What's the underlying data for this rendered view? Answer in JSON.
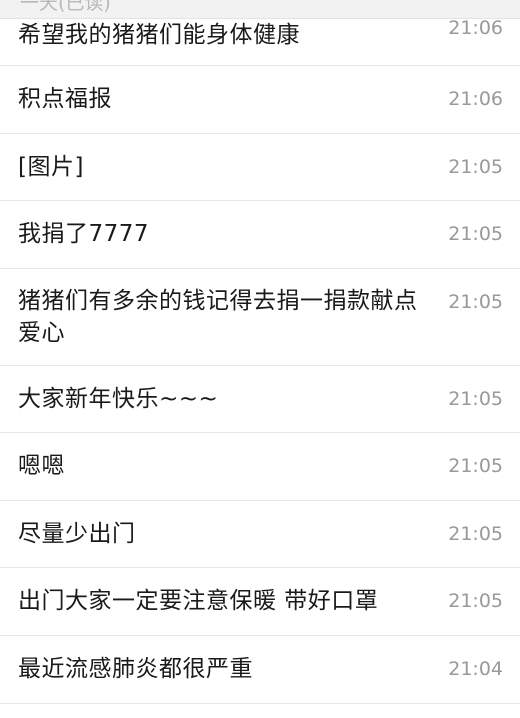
{
  "header": {
    "partial_label": "一天(已读)"
  },
  "messages": [
    {
      "text": "希望我的猪猪们能身体健康",
      "time": "21:06"
    },
    {
      "text": "积点福报",
      "time": "21:06"
    },
    {
      "text": "[图片]",
      "time": "21:05"
    },
    {
      "text": "我捐了7777",
      "time": "21:05"
    },
    {
      "text": "猪猪们有多余的钱记得去捐一捐款献点爱心",
      "time": "21:05"
    },
    {
      "text": "大家新年快乐~~~",
      "time": "21:05"
    },
    {
      "text": "嗯嗯",
      "time": "21:05"
    },
    {
      "text": "尽量少出门",
      "time": "21:05"
    },
    {
      "text": "出门大家一定要注意保暖 带好口罩",
      "time": "21:05"
    },
    {
      "text": "最近流感肺炎都很严重",
      "time": "21:04"
    }
  ]
}
